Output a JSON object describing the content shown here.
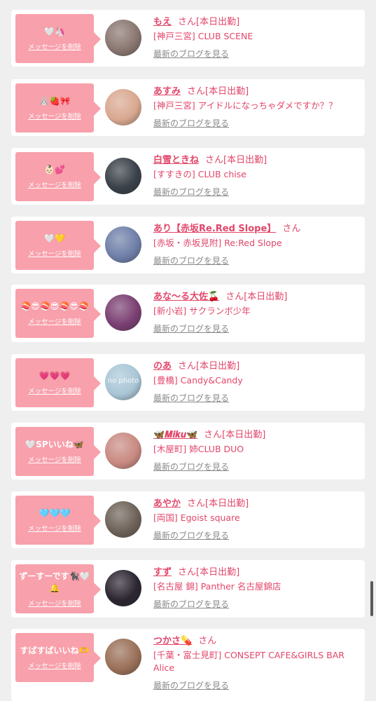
{
  "common": {
    "delete_label": "メッセージを削除",
    "san": "さん",
    "blog_label": "最新のブログを見る"
  },
  "cards": [
    {
      "message": "🤍🦄",
      "name": "もえ",
      "status": "[本日出勤]",
      "shop": "[神戸三宮] CLUB SCENE",
      "avatar_color": "#8a7670"
    },
    {
      "message": "🐰🍓🎀",
      "name": "あすみ",
      "status": "[本日出勤]",
      "shop": "[神戸三宮] アイドルになっちゃダメですか？？",
      "avatar_color": "#d9a890"
    },
    {
      "message": "👶🏻💕",
      "name": "白雪ときね",
      "status": "[本日出勤]",
      "shop": "[すすきの] CLUB chise",
      "avatar_color": "#3a4048"
    },
    {
      "message": "🤍💛",
      "name": "あり【赤坂Re.Red Slope】",
      "status": "",
      "shop": "[赤坂・赤坂見附] Re:Red Slope",
      "avatar_color": "#6f7fa8"
    },
    {
      "message": "🍣😎🍣😎🍣😎🍣",
      "name": "あな〜る大佐🍒",
      "status": "[本日出勤]",
      "shop": "[新小岩] サクランボ少年",
      "avatar_color": "#7a3f72"
    },
    {
      "message": "💗💗💗",
      "name": "のあ",
      "status": "[本日出勤]",
      "shop": "[豊橋] Candy&Candy",
      "avatar_color": "#a9c6d6",
      "avatar_text": "no photo"
    },
    {
      "message": "🤍SPいいね🦋",
      "name": "🦋𝑴𝒊𝒌𝒖🦋",
      "status": "[本日出勤]",
      "shop": "[木屋町] 姉CLUB DUO",
      "avatar_color": "#c98a82"
    },
    {
      "message": "🩵🩵🩵",
      "name": "あやか",
      "status": "[本日出勤]",
      "shop": "[両国] Egoist square",
      "avatar_color": "#6d6258"
    },
    {
      "message": "ずーすーです🐈‍⬛🤍🔔",
      "name": "すず",
      "status": "[本日出勤]",
      "shop": "[名古屋 錦] Panther 名古屋錦店",
      "avatar_color": "#2b2530"
    },
    {
      "message": "すばすばいいね🫶",
      "name": "つかさ💊",
      "status": "",
      "shop": "[千葉・富士見町] CONSEPT CAFE&GIRLS BAR Alice",
      "avatar_color": "#9a7058"
    }
  ]
}
